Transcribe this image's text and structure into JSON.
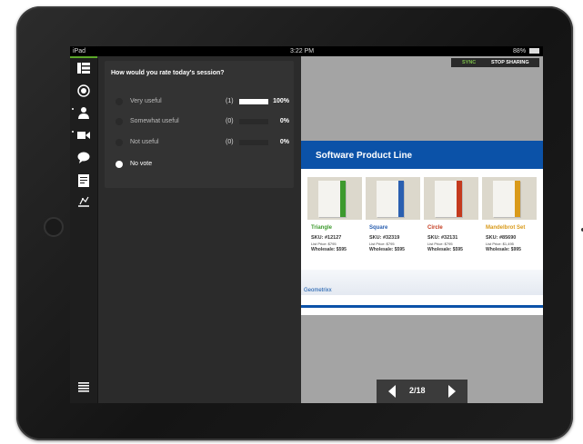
{
  "status_bar": {
    "device": "iPad",
    "time": "3:22 PM",
    "battery": "88%"
  },
  "poll": {
    "question": "How would you rate today's session?",
    "options": [
      {
        "label": "Very useful",
        "count": "(1)",
        "percent": "100%",
        "fraction": 1.0,
        "selected": false
      },
      {
        "label": "Somewhat useful",
        "count": "(0)",
        "percent": "0%",
        "fraction": 0.0,
        "selected": false
      },
      {
        "label": "Not useful",
        "count": "(0)",
        "percent": "0%",
        "fraction": 0.0,
        "selected": false
      },
      {
        "label": "No vote",
        "selected": true
      }
    ]
  },
  "toolbar": {
    "sync_label": "SYNC",
    "stop_sharing_label": "STOP SHARING"
  },
  "slide": {
    "title": "Software Product Line",
    "products": [
      {
        "name": "Triangle",
        "sku": "SKU: #12127",
        "list_price": "List Price: $795",
        "wholesale": "Wholesale: $595",
        "color": "#3d9a2e"
      },
      {
        "name": "Square",
        "sku": "SKU: #32319",
        "list_price": "List Price: $795",
        "wholesale": "Wholesale: $595",
        "color": "#2a5fb0"
      },
      {
        "name": "Circle",
        "sku": "SKU: #32131",
        "list_price": "List Price: $795",
        "wholesale": "Wholesale: $595",
        "color": "#c43a1e"
      },
      {
        "name": "Mandelbrot Set",
        "sku": "SKU: #85690",
        "list_price": "List Price: $1,495",
        "wholesale": "Wholesale: $995",
        "color": "#d99a1a"
      }
    ],
    "brand": "Geometrixx"
  },
  "pager": {
    "page": "2/18"
  },
  "icons": {
    "sidebar": [
      "slides-icon",
      "target-icon",
      "attendees-icon",
      "video-icon",
      "chat-icon",
      "notes-icon",
      "poll-icon",
      "menu-icon"
    ]
  },
  "colors": {
    "accent": "#5ba829",
    "slide_blue": "#0b52a8"
  }
}
